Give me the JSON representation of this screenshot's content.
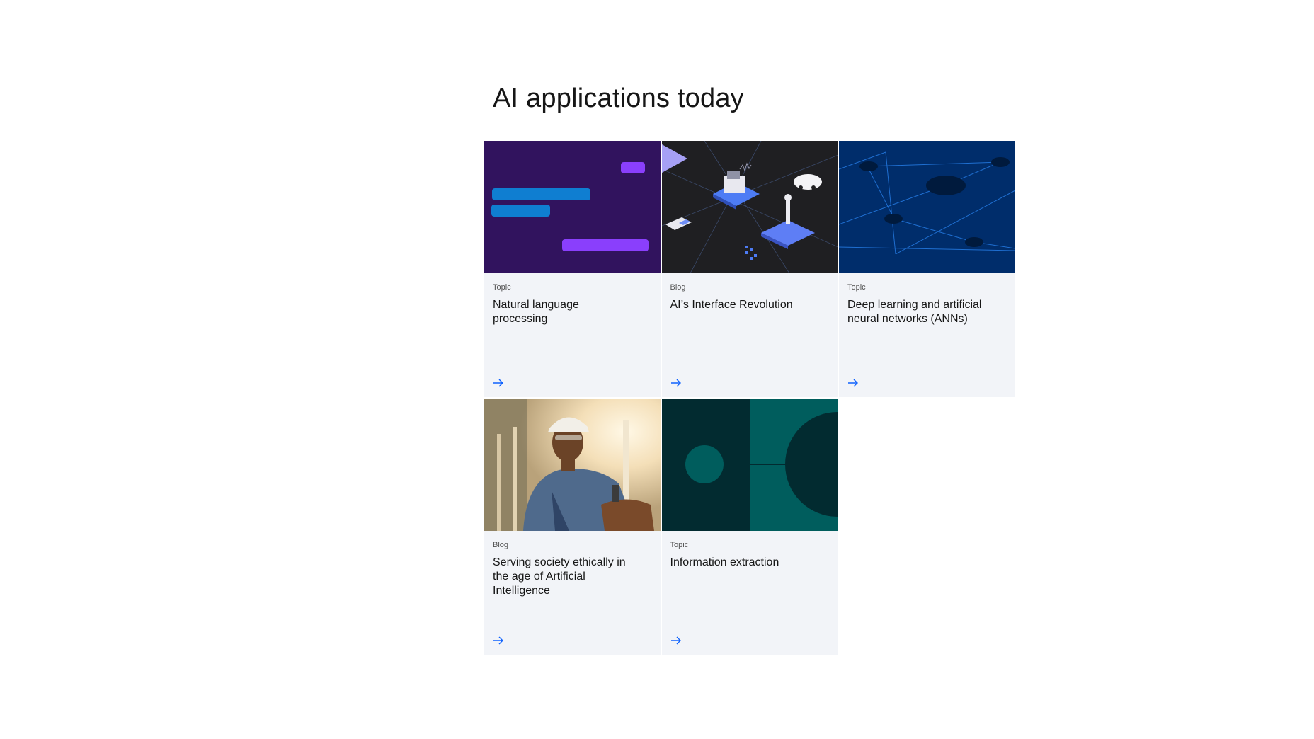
{
  "section": {
    "title": "AI applications today"
  },
  "cards": [
    {
      "eyebrow": "Topic",
      "title": "Natural language processing",
      "image": "nlp-chat-bubbles-illustration",
      "icon": "arrow-right-icon"
    },
    {
      "eyebrow": "Blog",
      "title": "AI’s Interface Revolution",
      "image": "isometric-ai-devices-illustration",
      "icon": "arrow-right-icon"
    },
    {
      "eyebrow": "Topic",
      "title": "Deep learning and artificial neural networks (ANNs)",
      "image": "neural-network-nodes-illustration",
      "icon": "arrow-right-icon"
    },
    {
      "eyebrow": "Blog",
      "title": "Serving society ethically in the age of Artificial Intelligence",
      "image": "construction-worker-photo",
      "icon": "arrow-right-icon"
    },
    {
      "eyebrow": "Topic",
      "title": "Information extraction",
      "image": "teal-circles-illustration",
      "icon": "arrow-right-icon"
    }
  ],
  "colors": {
    "accent": "#0f62fe",
    "card_bg": "#f2f4f8",
    "nlp_bg": "#31135e",
    "network_bg": "#002d6b",
    "extraction_bg": "#022b30"
  }
}
